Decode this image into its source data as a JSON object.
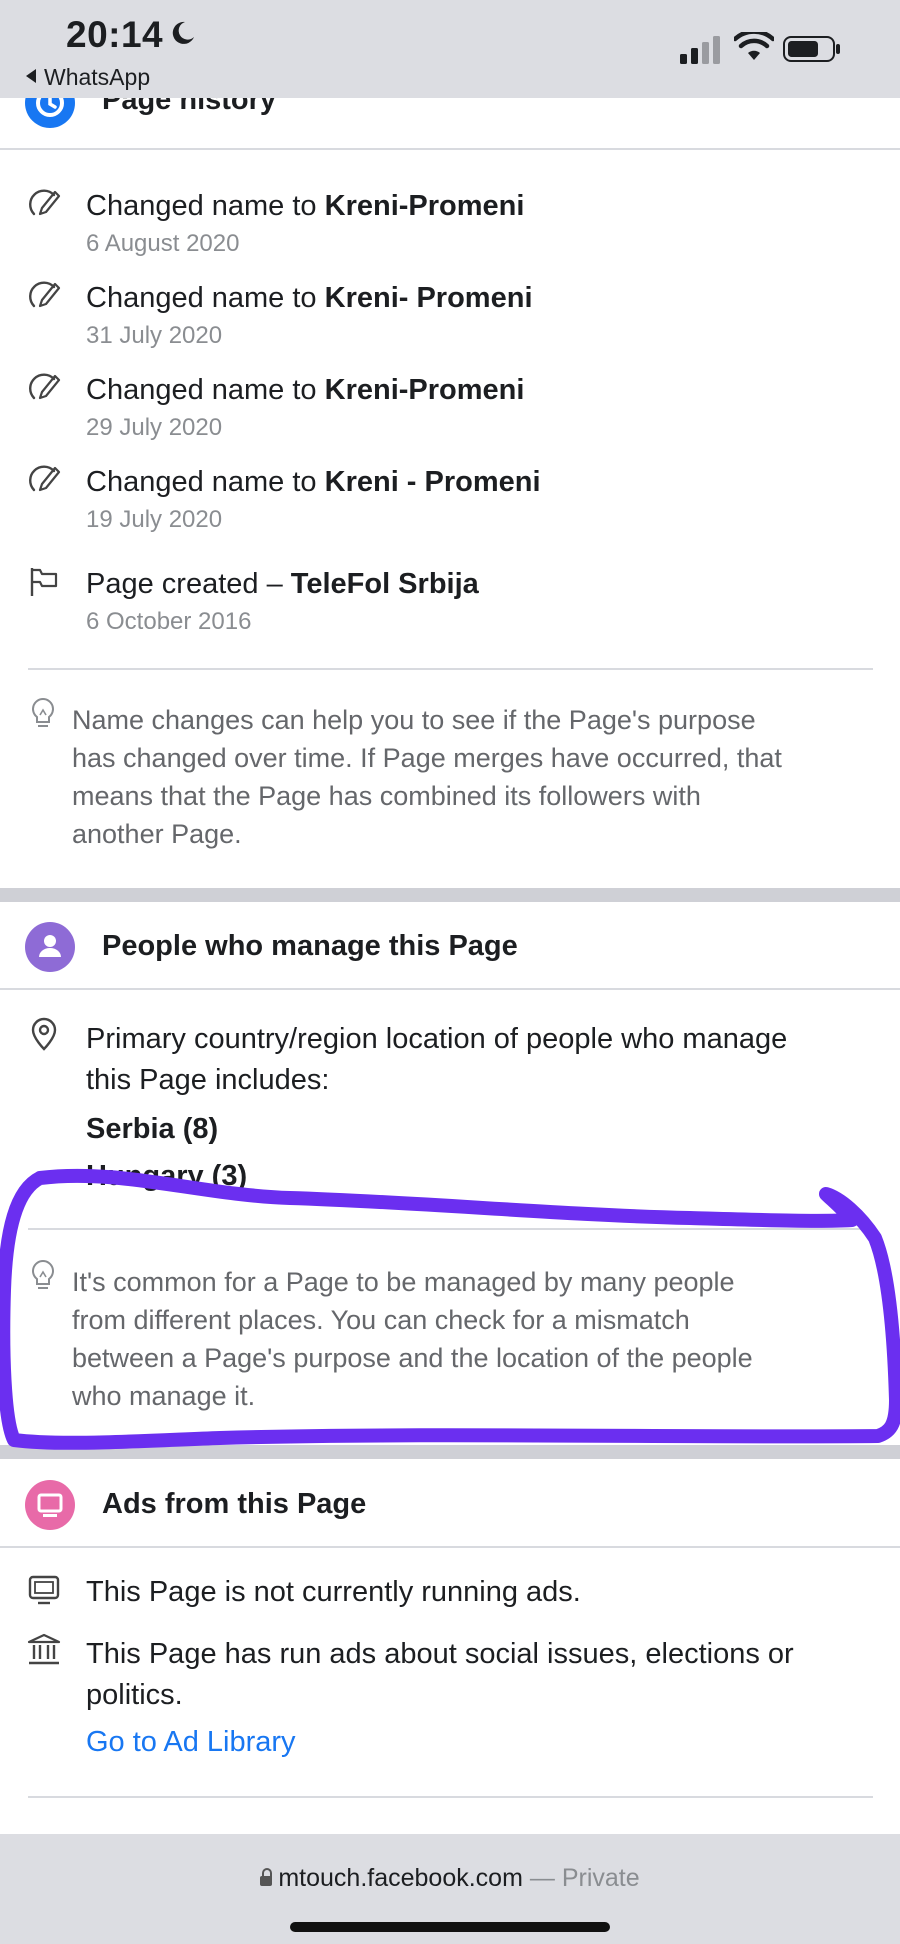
{
  "status_bar": {
    "time": "20:14",
    "back_app": "WhatsApp"
  },
  "page_history": {
    "title": "Page history",
    "entries": [
      {
        "prefix": "Changed name to ",
        "name": "Kreni-Promeni",
        "date": "6 August 2020",
        "icon": "edit-icon"
      },
      {
        "prefix": "Changed name to ",
        "name": "Kreni- Promeni",
        "date": "31 July 2020",
        "icon": "edit-icon"
      },
      {
        "prefix": "Changed name to ",
        "name": "Kreni-Promeni",
        "date": "29 July 2020",
        "icon": "edit-icon"
      },
      {
        "prefix": "Changed name to ",
        "name": "Kreni - Promeni",
        "date": "19 July 2020",
        "icon": "edit-icon"
      },
      {
        "prefix": "Page created – ",
        "name": "TeleFol Srbija",
        "date": "6 October 2016",
        "icon": "flag-icon"
      }
    ],
    "tip_lines": [
      "Name changes can help you to see if the Page's purpose",
      "has changed over time. If Page merges have occurred, that",
      "means that the Page has combined its followers with",
      "another Page."
    ]
  },
  "people_manage": {
    "title": "People who manage this Page",
    "location_lines": [
      "Primary country/region location of people who manage",
      "this Page includes:"
    ],
    "countries": [
      "Serbia (8)",
      "Hungary (3)"
    ],
    "tip_lines": [
      "It's common for a Page to be managed by many people",
      "from different places. You can check for a mismatch",
      "between a Page's purpose and the location of the people",
      "who manage it."
    ]
  },
  "ads": {
    "title": "Ads from this Page",
    "not_running": "This Page is not currently running ads.",
    "social_lines": [
      "This Page has run ads about social issues, elections or",
      "politics."
    ],
    "link": "Go to Ad Library"
  },
  "bottom_bar": {
    "url": "mtouch.facebook.com",
    "separator": " — ",
    "private": "Private"
  },
  "colors": {
    "history_icon": "#1877f2",
    "people_icon": "#8e6bd6",
    "ads_icon": "#e86aa8",
    "annotation": "#6b2ff0",
    "link": "#1877f2"
  }
}
